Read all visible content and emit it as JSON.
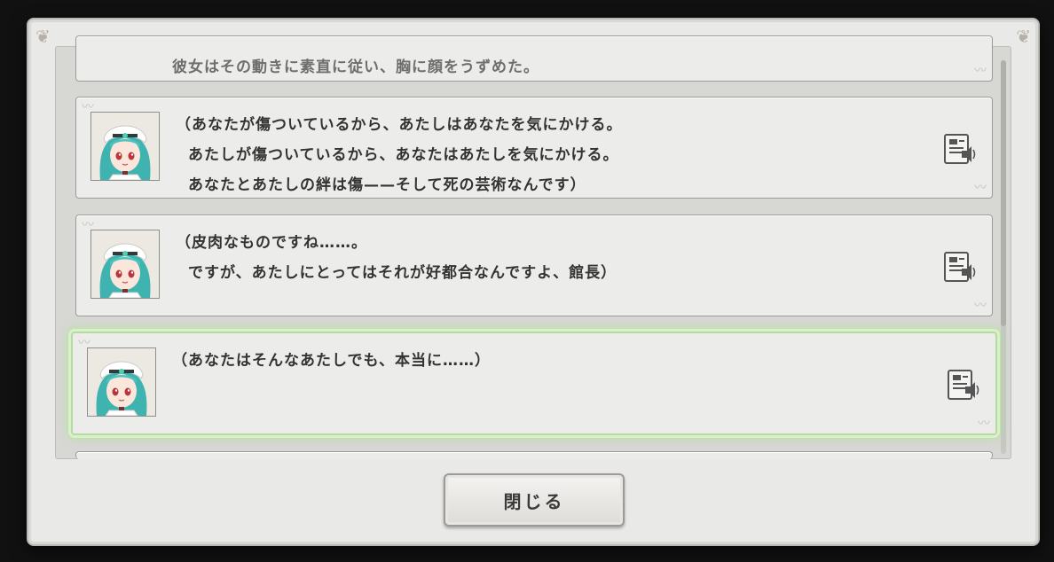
{
  "backlog": {
    "entries": [
      {
        "speaker_portrait": "nurse-girl-portrait",
        "has_voice": false,
        "lines": [
          "彼女はその動きに素直に従い、胸に顔をうずめた。"
        ]
      },
      {
        "speaker_portrait": "nurse-girl-portrait",
        "has_voice": true,
        "lines": [
          "（あなたが傷ついているから、あたしはあなたを気にかける。",
          "あたしが傷ついているから、あなたはあたしを気にかける。",
          "あなたとあたしの絆は傷——そして死の芸術なんです）"
        ]
      },
      {
        "speaker_portrait": "nurse-girl-portrait",
        "has_voice": true,
        "lines": [
          "（皮肉なものですね……。",
          "ですが、あたしにとってはそれが好都合なんですよ、館長）"
        ]
      },
      {
        "speaker_portrait": "nurse-girl-portrait",
        "has_voice": true,
        "highlighted": true,
        "lines": [
          "（あなたはそんなあたしでも、本当に……）"
        ]
      }
    ]
  },
  "close_button": {
    "label": "閉じる"
  },
  "icons": {
    "voice": "voice-replay-icon"
  },
  "colors": {
    "highlight": "#b7d9a4",
    "panel": "#e9e9e7",
    "text": "#333333"
  }
}
